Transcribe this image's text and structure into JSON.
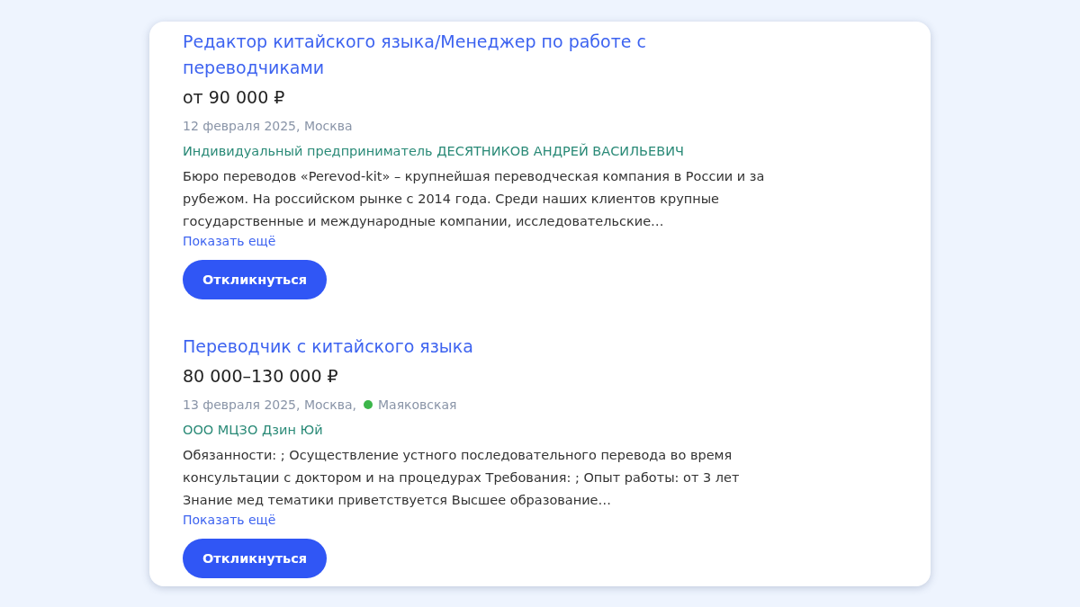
{
  "vacancies": [
    {
      "title": "Редактор китайского языка/Менеджер по работе с переводчиками",
      "salary": "от 90 000 ₽",
      "date_city": "12 февраля 2025, Москва",
      "employer": "Индивидуальный предприниматель ДЕСЯТНИКОВ АНДРЕЙ ВАСИЛЬЕВИЧ",
      "description": "Бюро переводов «Perevod-kit» – крупнейшая переводческая компания в России и за рубежом. На российском рынке с 2014 года. Среди наших клиентов крупные государственные и международные компании, исследовательские…",
      "show_more": "Показать ещё",
      "button": "Откликнуться"
    },
    {
      "title": "Переводчик с китайского языка",
      "salary": "80 000–130 000 ₽",
      "date_city": "13 февраля 2025, Москва,",
      "metro": {
        "name": "Маяковская",
        "color": "#3cb64a"
      },
      "employer": "ООО МЦЗО Дзин Юй",
      "description": "Обязанности: ; Осуществление устного последовательного перевода во время консультации с доктором и на процедурах Требования: ; Опыт работы: от 3 лет Знание мед тематики приветствуется Высшее образование…",
      "show_more": "Показать ещё",
      "button": "Откликнуться"
    }
  ]
}
